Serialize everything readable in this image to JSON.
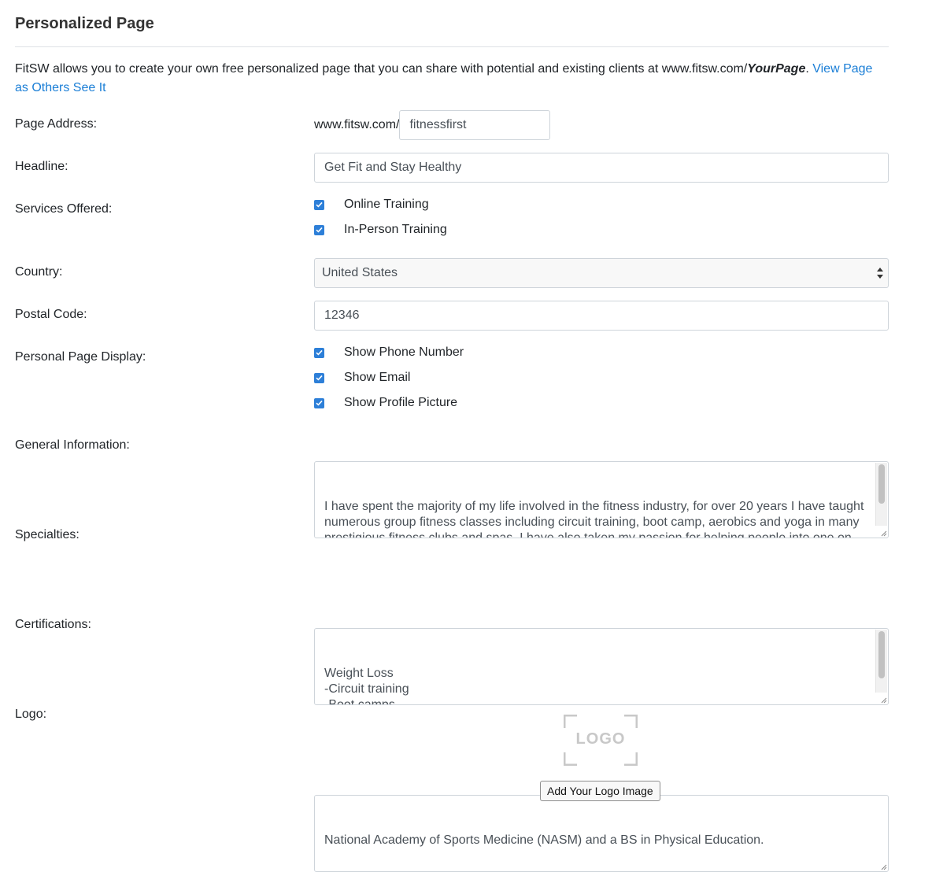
{
  "page": {
    "title": "Personalized Page",
    "intro_text": "FitSW allows you to create your own free personalized page that you can share with potential and existing clients at www.fitsw.com/",
    "intro_emphasis": "YourPage",
    "intro_period": ". ",
    "view_link": "View Page as Others See It"
  },
  "fields": {
    "page_address": {
      "label": "Page Address:",
      "prefix": "www.fitsw.com/",
      "value": "fitnessfirst"
    },
    "headline": {
      "label": "Headline:",
      "value": "Get Fit and Stay Healthy"
    },
    "services": {
      "label": "Services Offered:",
      "options": [
        {
          "label": "Online Training",
          "checked": true
        },
        {
          "label": "In-Person Training",
          "checked": true
        }
      ]
    },
    "country": {
      "label": "Country:",
      "value": "United States"
    },
    "postal_code": {
      "label": "Postal Code:",
      "value": "12346"
    },
    "display": {
      "label": "Personal Page Display:",
      "options": [
        {
          "label": "Show Phone Number",
          "checked": true
        },
        {
          "label": "Show Email",
          "checked": true
        },
        {
          "label": "Show Profile Picture",
          "checked": true
        }
      ]
    },
    "general_info": {
      "label": "General Information:",
      "value": "I have spent the majority of my life involved in the fitness industry, for over 20 years I have taught numerous group fitness classes including circuit training, boot camp, aerobics and yoga in many prestigious fitness clubs and spas. I have also taken my passion for helping people into one on one personal training where I have helped hundreds of women achieve amazing results on many levels. I hold a BS degree in Physical Education and a minor in Exercise Nutrition."
    },
    "specialties": {
      "label": "Specialties:",
      "value": "Weight Loss\n-Circuit training\n-Boot camps\n-Aerobics\n-Yoga"
    },
    "certifications": {
      "label": "Certifications:",
      "value": "National Academy of Sports Medicine (NASM) and a BS in Physical Education."
    },
    "logo": {
      "label": "Logo:",
      "placeholder_text": "LOGO",
      "button_label": "Add Your Logo Image"
    }
  },
  "colors": {
    "accent": "#2d7fd8",
    "link": "#1a7ed6",
    "border": "#ced4da"
  }
}
